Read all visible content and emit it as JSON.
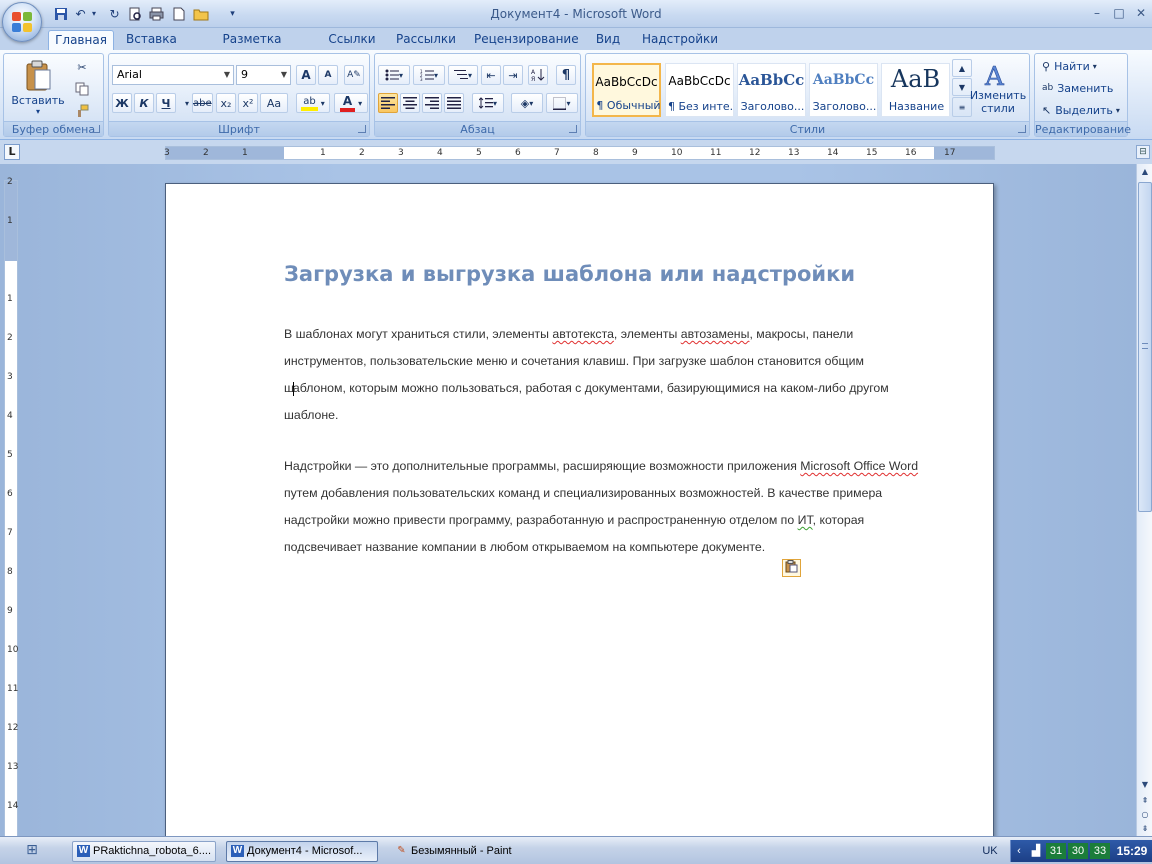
{
  "window": {
    "title": "Документ4 - Microsoft Word"
  },
  "tabs": [
    {
      "label": "Главная"
    },
    {
      "label": "Вставка"
    },
    {
      "label": "Разметка страницы"
    },
    {
      "label": "Ссылки"
    },
    {
      "label": "Рассылки"
    },
    {
      "label": "Рецензирование"
    },
    {
      "label": "Вид"
    },
    {
      "label": "Надстройки"
    }
  ],
  "ribbon": {
    "clipboard": {
      "label": "Буфер обмена",
      "paste_label": "Вставить"
    },
    "font": {
      "label": "Шрифт",
      "font_name": "Arial",
      "font_size": "9",
      "bold": "Ж",
      "italic": "К",
      "underline": "Ч",
      "strike": "abe",
      "grow": "A",
      "shrink": "A",
      "case": "Aa"
    },
    "paragraph": {
      "label": "Абзац",
      "pilcrow": "¶"
    },
    "styles": {
      "label": "Стили",
      "items": [
        {
          "sample": "AaBbCcDc",
          "name": "¶ Обычный"
        },
        {
          "sample": "AaBbCcDc",
          "name": "¶ Без инте..."
        },
        {
          "sample": "AaBbCc",
          "name": "Заголово..."
        },
        {
          "sample": "AaBbCc",
          "name": "Заголово..."
        },
        {
          "sample": "AaB",
          "name": "Название"
        }
      ],
      "change_styles_line1": "Изменить",
      "change_styles_line2": "стили"
    },
    "editing": {
      "label": "Редактирование",
      "find": "Найти",
      "replace": "Заменить",
      "select": "Выделить"
    }
  },
  "ruler": {
    "tab_selector": "L",
    "h_numbers": [
      "3",
      "2",
      "1",
      "1",
      "2",
      "3",
      "4",
      "5",
      "6",
      "7",
      "8",
      "9",
      "10",
      "11",
      "12",
      "13",
      "14",
      "15",
      "16",
      "17"
    ],
    "v_numbers": [
      "2",
      "1",
      "1",
      "2",
      "3",
      "4",
      "5",
      "6",
      "7",
      "8",
      "9",
      "10",
      "11",
      "12",
      "13",
      "14"
    ]
  },
  "document": {
    "title": "Загрузка и выгрузка шаблона или надстройки",
    "p1": {
      "l1a": "В шаблонах могут храниться стили, элементы ",
      "l1b": "автотекста",
      "l1c": ", элементы ",
      "l1d": "автозамены",
      "l1e": ", макросы, панели",
      "l2": "инструментов, пользовательские меню и сочетания клавиш. При загрузке шаблон становится общим",
      "l3a": "ш",
      "l3b": "аблоном, которым можно пользоваться, работая с документами, базирующимися на каком-либо другом",
      "l4": "шаблоне."
    },
    "p2": {
      "l1a": "Надстройки — это дополнительные программы, расширяющие возможности приложения ",
      "l1b": "Microsoft Office Word",
      "l2": "путем добавления пользовательских команд и специализированных возможностей. В качестве примера",
      "l3a": "надстройки можно привести программу, разработанную и распространенную отделом по ",
      "l3b": "ИТ",
      "l3c": ", которая",
      "l4": "подсвечивает название компании в любом открываемом на компьютере документе."
    }
  },
  "taskbar": {
    "tasks": [
      {
        "label": "PRaktichna_robota_6...."
      },
      {
        "label": "Документ4 - Microsof..."
      },
      {
        "label": "Безымянный - Paint"
      }
    ],
    "language": "UK",
    "tray_numbers": [
      "31",
      "30",
      "33"
    ],
    "clock": "15:29"
  },
  "colors": {
    "accent": "#15428b",
    "title_text": "#6f8db9",
    "selected_style": "#f3b64b"
  }
}
